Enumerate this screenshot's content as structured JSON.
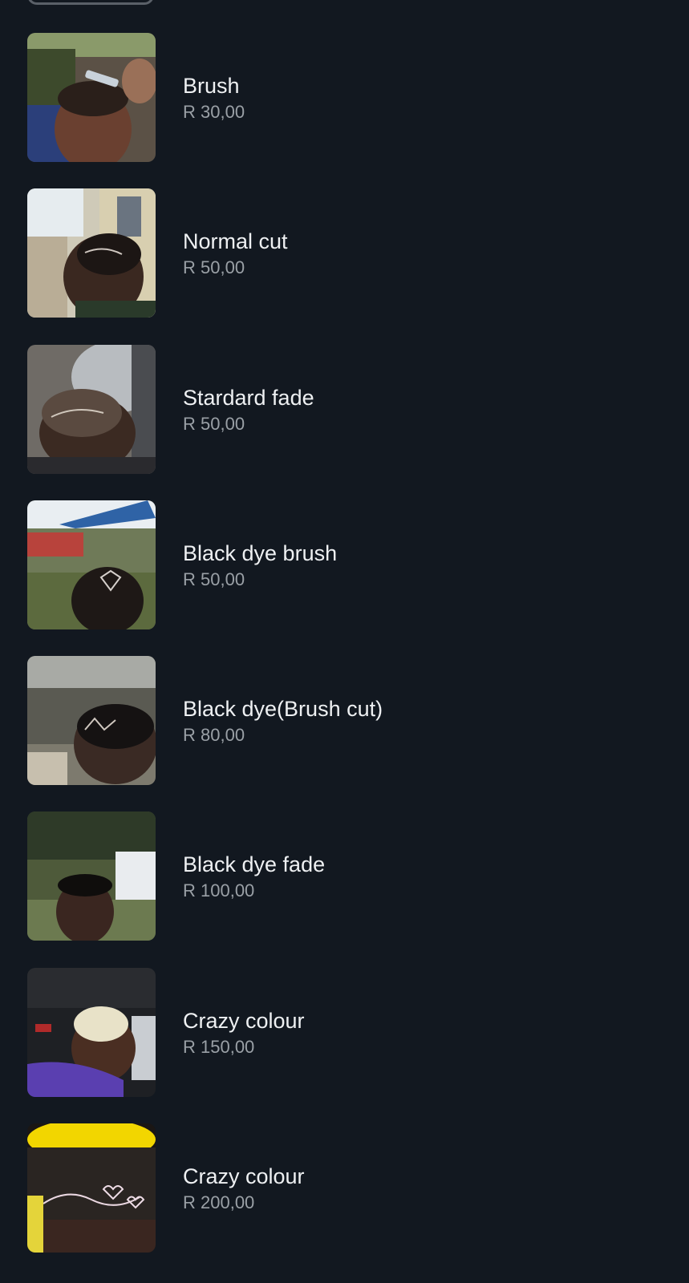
{
  "catalog": {
    "items": [
      {
        "name": "Brush",
        "price": "R 30,00",
        "thumbnail_icon": "haircut-photo"
      },
      {
        "name": "Normal cut",
        "price": "R 50,00",
        "thumbnail_icon": "haircut-photo"
      },
      {
        "name": "Stardard fade",
        "price": "R 50,00",
        "thumbnail_icon": "haircut-photo"
      },
      {
        "name": "Black dye brush",
        "price": "R 50,00",
        "thumbnail_icon": "haircut-photo"
      },
      {
        "name": "Black dye(Brush cut)",
        "price": "R 80,00",
        "thumbnail_icon": "haircut-photo"
      },
      {
        "name": "Black dye fade",
        "price": "R 100,00",
        "thumbnail_icon": "haircut-photo"
      },
      {
        "name": "Crazy colour",
        "price": "R 150,00",
        "thumbnail_icon": "haircut-photo"
      },
      {
        "name": "Crazy colour",
        "price": "R 200,00",
        "thumbnail_icon": "haircut-photo"
      }
    ]
  },
  "colors": {
    "background": "#121820",
    "title_text": "#eef0f2",
    "price_text": "#9aa0a6"
  }
}
